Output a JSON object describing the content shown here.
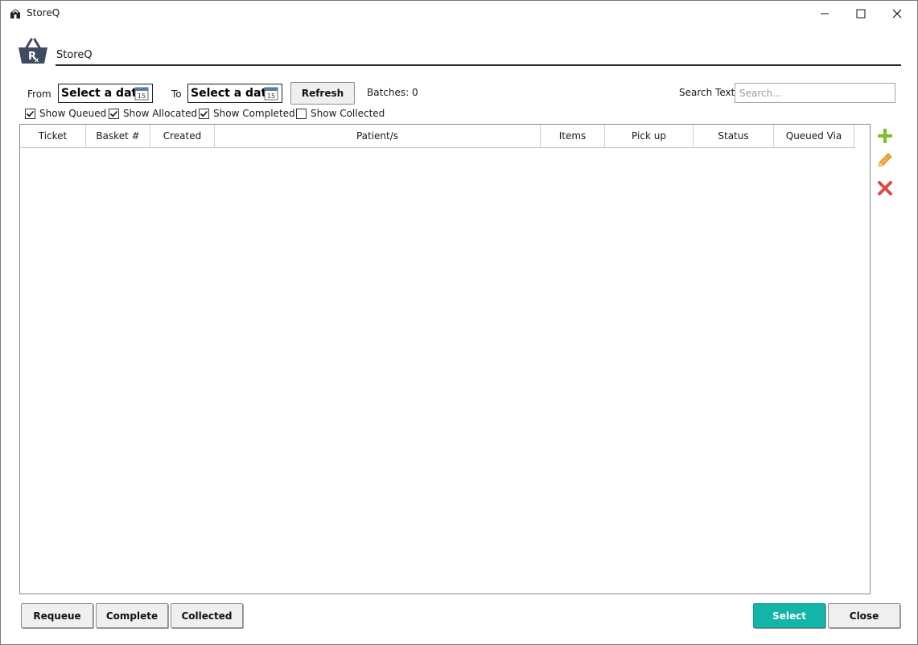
{
  "window": {
    "title": "StoreQ"
  },
  "header": {
    "app_name": "StoreQ"
  },
  "filters": {
    "from_label": "From",
    "from_value": "Select a date",
    "to_label": "To",
    "to_value": "Select a date",
    "calendar_day": "15",
    "refresh_label": "Refresh",
    "batches_label": "Batches: 0",
    "search_label": "Search Text",
    "search_placeholder": "Search...",
    "search_value": ""
  },
  "checkboxes": [
    {
      "label": "Show Queued",
      "checked": true
    },
    {
      "label": "Show Allocated",
      "checked": true
    },
    {
      "label": "Show Completed",
      "checked": true
    },
    {
      "label": "Show Collected",
      "checked": false
    }
  ],
  "grid": {
    "columns": [
      "Ticket",
      "Basket #",
      "Created",
      "Patient/s",
      "Items",
      "Pick up",
      "Status",
      "Queued Via"
    ],
    "rows": []
  },
  "side_actions": {
    "add": "plus-icon",
    "edit": "pencil-icon",
    "delete": "x-icon"
  },
  "bottom_buttons": {
    "requeue": "Requeue",
    "complete": "Complete",
    "collected": "Collected",
    "select": "Select",
    "close": "Close"
  },
  "colors": {
    "select_button": "#13b5a8",
    "add_icon": "#7cbf2f",
    "edit_icon": "#f0a030",
    "delete_icon": "#e04848",
    "logo": "#3f4b5e"
  }
}
